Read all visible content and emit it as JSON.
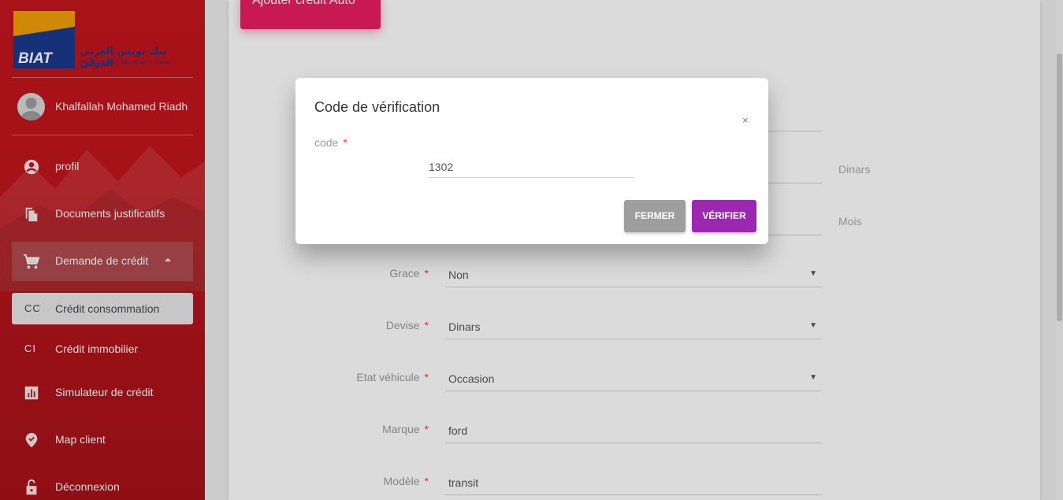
{
  "brand": {
    "logo_text": "BIAT",
    "arabic_name": "بنك تونس العربي الدولي",
    "subtitle": "BANQUE INTERNATIONALE ARABE DE TUNISIE"
  },
  "user": {
    "name": "Khalfallah Mohamed Riadh"
  },
  "sidebar": {
    "items": [
      {
        "label": "profil",
        "icon": "account-circle-icon"
      },
      {
        "label": "Documents justificatifs",
        "icon": "file-copy-icon"
      },
      {
        "label": "Demande de crédit",
        "icon": "cart-icon",
        "expanded": true
      },
      {
        "label": "Simulateur de crédit",
        "icon": "chart-icon"
      },
      {
        "label": "Map client",
        "icon": "location-pin-icon"
      },
      {
        "label": "Déconnexion",
        "icon": "lock-open-icon"
      }
    ],
    "subitems": [
      {
        "abbr": "CC",
        "label": "Crédit consommation",
        "active": true
      },
      {
        "abbr": "CI",
        "label": "Crédit immobilier",
        "active": false
      }
    ]
  },
  "main": {
    "header_button": "Ajouter crédit Auto",
    "suffix_amount": "Dinars",
    "suffix_duration": "Mois",
    "form": [
      {
        "label": "Grace",
        "value": "Non",
        "type": "select"
      },
      {
        "label": "Devise",
        "value": "Dinars",
        "type": "select"
      },
      {
        "label": "Etat véhicule",
        "value": "Occasion",
        "type": "select"
      },
      {
        "label": "Marque",
        "value": "ford",
        "type": "text"
      },
      {
        "label": "Modèle",
        "value": "transit",
        "type": "text"
      }
    ]
  },
  "modal": {
    "title": "Code de vérification",
    "close_symbol": "×",
    "code_label": "code",
    "code_value": "1302",
    "close_button": "FERMER",
    "verify_button": "VÉRIFIER"
  },
  "colors": {
    "sidebar": "#c4161c",
    "primary": "#e91e63",
    "verify": "#9c27b0",
    "close": "#9e9e9e",
    "required": "#f44336"
  }
}
